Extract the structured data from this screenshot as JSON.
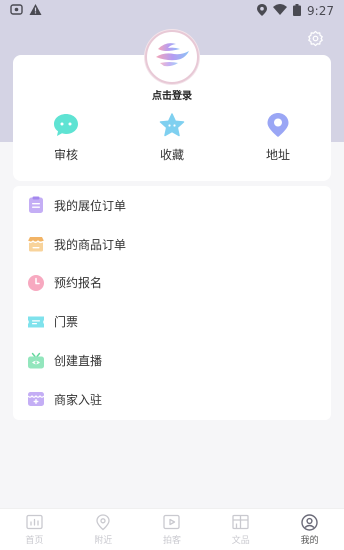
{
  "status_bar": {
    "time": "9:27"
  },
  "profile": {
    "login_label": "点击登录"
  },
  "quick_actions": [
    {
      "label": "审核",
      "icon": "chat-bubble-icon",
      "color": "#5fe3d3"
    },
    {
      "label": "收藏",
      "icon": "star-icon",
      "color": "#7fd0f0"
    },
    {
      "label": "地址",
      "icon": "location-pin-icon",
      "color": "#9aa6f5"
    }
  ],
  "menu": [
    {
      "label": "我的展位订单",
      "icon": "booth-order-icon",
      "color": "#b79af0"
    },
    {
      "label": "我的商品订单",
      "icon": "shop-order-icon",
      "color": "#f5c98a"
    },
    {
      "label": "预约报名",
      "icon": "clock-icon",
      "color": "#f59ab4"
    },
    {
      "label": "门票",
      "icon": "ticket-icon",
      "color": "#6fdde8"
    },
    {
      "label": "创建直播",
      "icon": "tv-live-icon",
      "color": "#7ee0b0"
    },
    {
      "label": "商家入驻",
      "icon": "merchant-icon",
      "color": "#b79af0"
    }
  ],
  "tabs": [
    {
      "label": "首页",
      "icon": "chart-board-icon",
      "active": false
    },
    {
      "label": "附近",
      "icon": "map-pin-icon",
      "active": false
    },
    {
      "label": "拍客",
      "icon": "video-play-icon",
      "active": false
    },
    {
      "label": "文品",
      "icon": "storefront-icon",
      "active": false
    },
    {
      "label": "我的",
      "icon": "user-profile-icon",
      "active": true
    }
  ]
}
